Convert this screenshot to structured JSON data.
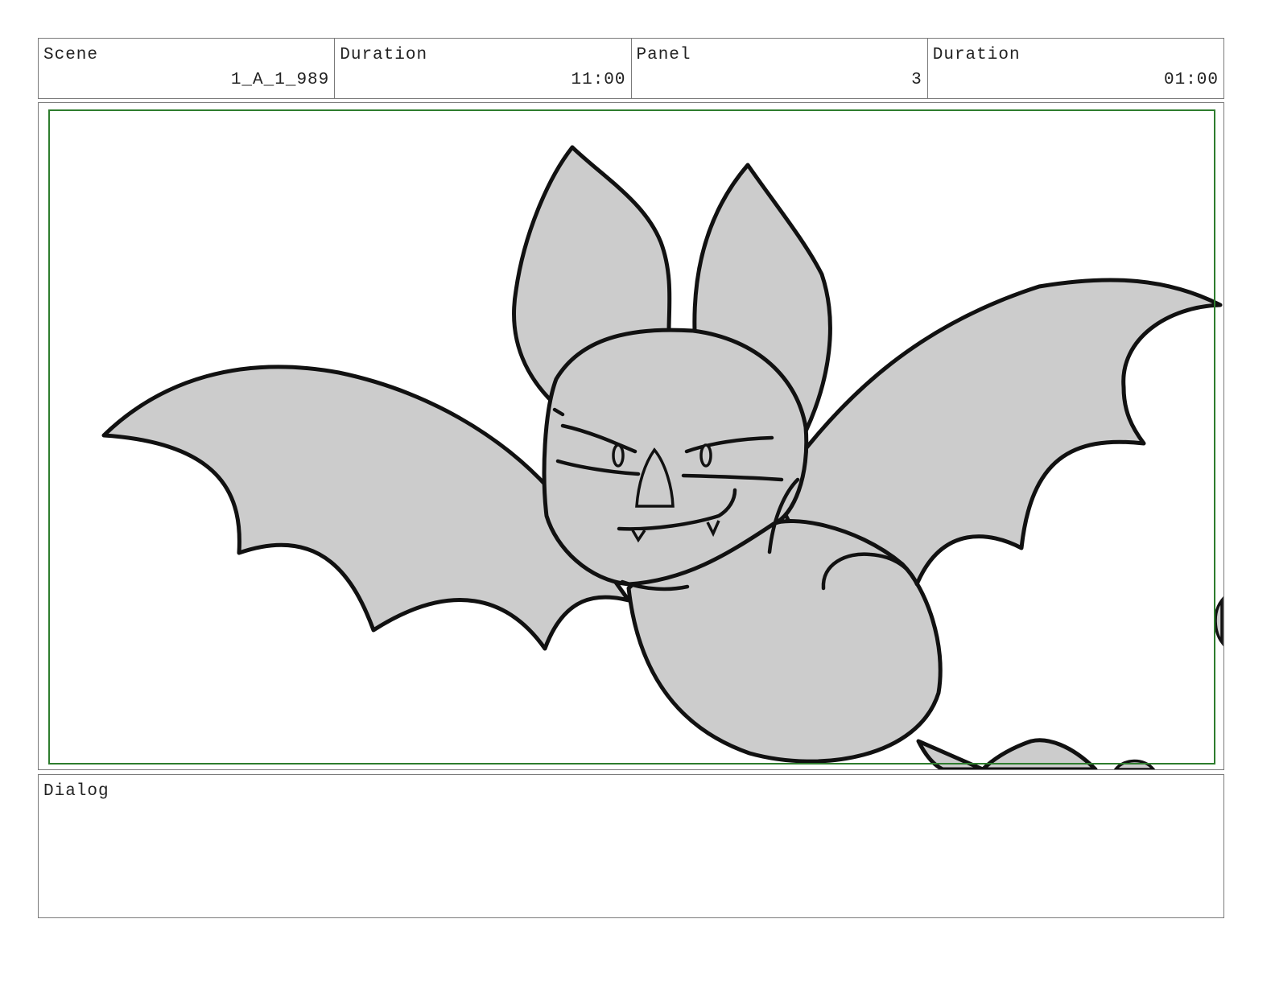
{
  "header": {
    "scene": {
      "label": "Scene",
      "value": "1_A_1_989"
    },
    "scene_duration": {
      "label": "Duration",
      "value": "11:00"
    },
    "panel": {
      "label": "Panel",
      "value": "3"
    },
    "panel_duration": {
      "label": "Duration",
      "value": "01:00"
    }
  },
  "dialog": {
    "label": "Dialog",
    "text": ""
  },
  "colors": {
    "safe_frame": "#2e7d2e",
    "border": "#7a7a7a",
    "fill": "#cccccc",
    "ink": "#111111"
  },
  "artwork": {
    "subject": "bat-drawing"
  }
}
